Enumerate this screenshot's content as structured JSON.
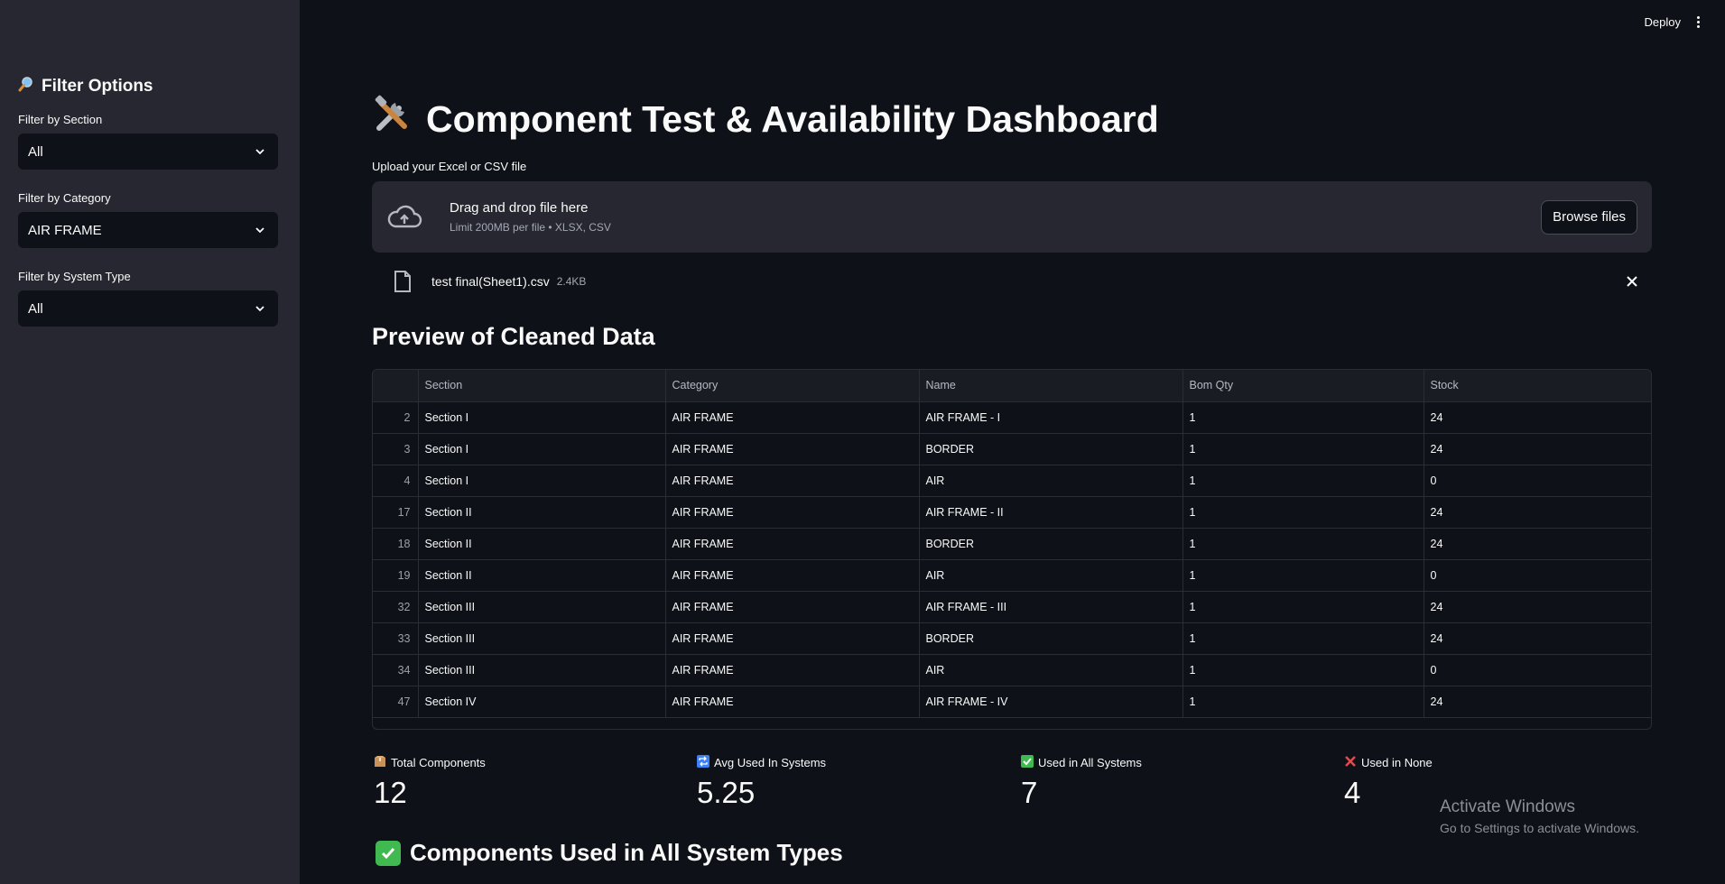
{
  "topbar": {
    "deploy_label": "Deploy"
  },
  "sidebar": {
    "title": "Filter Options",
    "title_icon": "magnifier-emoji",
    "filters": [
      {
        "label": "Filter by Section",
        "value": "All"
      },
      {
        "label": "Filter by Category",
        "value": "AIR FRAME"
      },
      {
        "label": "Filter by System Type",
        "value": "All"
      }
    ]
  },
  "main": {
    "title": "Component Test & Availability Dashboard",
    "title_icon": "tools-emoji",
    "upload": {
      "label": "Upload your Excel or CSV file",
      "drop_text": "Drag and drop file here",
      "limit_text": "Limit 200MB per file • XLSX, CSV",
      "browse_label": "Browse files"
    },
    "file": {
      "name": "test final(Sheet1).csv",
      "size": "2.4KB"
    },
    "preview_title": "Preview of Cleaned Data",
    "table": {
      "columns": [
        "",
        "Section",
        "Category",
        "Name",
        "Bom Qty",
        "Stock"
      ],
      "rows": [
        [
          "2",
          "Section I",
          "AIR FRAME",
          "AIR FRAME - I",
          "1",
          "24"
        ],
        [
          "3",
          "Section I",
          "AIR FRAME",
          "BORDER",
          "1",
          "24"
        ],
        [
          "4",
          "Section I",
          "AIR FRAME",
          "AIR",
          "1",
          "0"
        ],
        [
          "17",
          "Section II",
          "AIR FRAME",
          "AIR FRAME - II",
          "1",
          "24"
        ],
        [
          "18",
          "Section II",
          "AIR FRAME",
          "BORDER",
          "1",
          "24"
        ],
        [
          "19",
          "Section II",
          "AIR FRAME",
          "AIR",
          "1",
          "0"
        ],
        [
          "32",
          "Section III",
          "AIR FRAME",
          "AIR FRAME - III",
          "1",
          "24"
        ],
        [
          "33",
          "Section III",
          "AIR FRAME",
          "BORDER",
          "1",
          "24"
        ],
        [
          "34",
          "Section III",
          "AIR FRAME",
          "AIR",
          "1",
          "0"
        ],
        [
          "47",
          "Section IV",
          "AIR FRAME",
          "AIR FRAME - IV",
          "1",
          "24"
        ]
      ]
    },
    "metrics": [
      {
        "label": "Total Components",
        "value": "12",
        "icon": "package-emoji"
      },
      {
        "label": "Avg Used In Systems",
        "value": "5.25",
        "icon": "repeat-emoji"
      },
      {
        "label": "Used in All Systems",
        "value": "7",
        "icon": "check-emoji"
      },
      {
        "label": "Used in None",
        "value": "4",
        "icon": "cross-emoji"
      }
    ],
    "section2_title": "Components Used in All System Types"
  },
  "watermark": {
    "line1": "Activate Windows",
    "line2": "Go to Settings to activate Windows."
  },
  "colors": {
    "bg": "#0e1117",
    "sidebar": "#262730",
    "check_green": "#3fb950",
    "cross_red": "#e5484d"
  }
}
